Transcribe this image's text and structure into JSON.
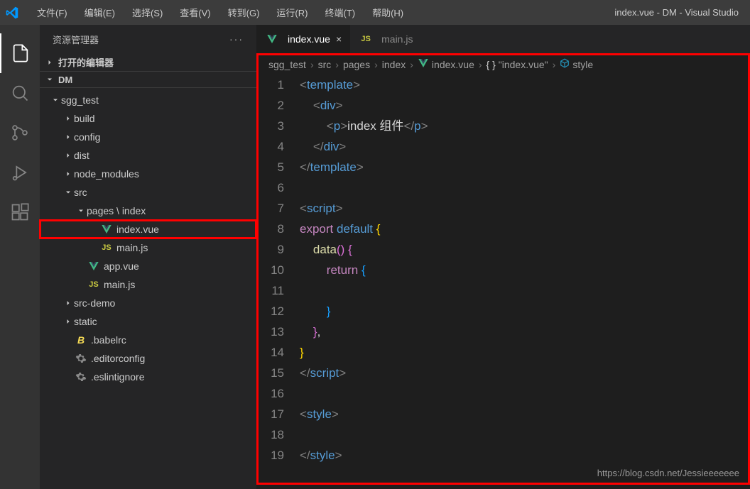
{
  "menus": [
    "文件(F)",
    "编辑(E)",
    "选择(S)",
    "查看(V)",
    "转到(G)",
    "运行(R)",
    "终端(T)",
    "帮助(H)"
  ],
  "window_title": "index.vue - DM - Visual Studio",
  "sidebar": {
    "title": "资源管理器",
    "open_editors": "打开的编辑器",
    "workspace": "DM"
  },
  "tree": [
    {
      "depth": 0,
      "type": "folder",
      "open": true,
      "label": "sgg_test"
    },
    {
      "depth": 1,
      "type": "folder",
      "open": false,
      "label": "build"
    },
    {
      "depth": 1,
      "type": "folder",
      "open": false,
      "label": "config"
    },
    {
      "depth": 1,
      "type": "folder",
      "open": false,
      "label": "dist"
    },
    {
      "depth": 1,
      "type": "folder",
      "open": false,
      "label": "node_modules"
    },
    {
      "depth": 1,
      "type": "folder",
      "open": true,
      "label": "src"
    },
    {
      "depth": 2,
      "type": "folder",
      "open": true,
      "label": "pages \\ index"
    },
    {
      "depth": 3,
      "type": "file",
      "icon": "vue",
      "label": "index.vue",
      "highlight": true,
      "selected": false
    },
    {
      "depth": 3,
      "type": "file",
      "icon": "js",
      "label": "main.js"
    },
    {
      "depth": 2,
      "type": "file",
      "icon": "vue",
      "label": "app.vue"
    },
    {
      "depth": 2,
      "type": "file",
      "icon": "js",
      "label": "main.js"
    },
    {
      "depth": 1,
      "type": "folder",
      "open": false,
      "label": "src-demo"
    },
    {
      "depth": 1,
      "type": "folder",
      "open": false,
      "label": "static"
    },
    {
      "depth": 1,
      "type": "file",
      "icon": "babel",
      "label": ".babelrc"
    },
    {
      "depth": 1,
      "type": "file",
      "icon": "gear",
      "label": ".editorconfig"
    },
    {
      "depth": 1,
      "type": "file",
      "icon": "gear",
      "label": ".eslintignore"
    }
  ],
  "tabs": [
    {
      "icon": "vue",
      "label": "index.vue",
      "active": true,
      "close": true
    },
    {
      "icon": "js",
      "label": "main.js",
      "active": false,
      "close": false
    }
  ],
  "breadcrumbs": [
    "sgg_test",
    "src",
    "pages",
    "index",
    "index.vue",
    "\"index.vue\"",
    "style"
  ],
  "breadcrumb_icons": [
    "",
    "",
    "",
    "",
    "vue",
    "braces",
    "cube"
  ],
  "code": [
    [
      {
        "c": "tk-gray",
        "t": "<"
      },
      {
        "c": "tk-tag",
        "t": "template"
      },
      {
        "c": "tk-gray",
        "t": ">"
      }
    ],
    [
      {
        "c": "",
        "t": "    "
      },
      {
        "c": "tk-gray",
        "t": "<"
      },
      {
        "c": "tk-tag",
        "t": "div"
      },
      {
        "c": "tk-gray",
        "t": ">"
      }
    ],
    [
      {
        "c": "",
        "t": "        "
      },
      {
        "c": "tk-gray",
        "t": "<"
      },
      {
        "c": "tk-tag",
        "t": "p"
      },
      {
        "c": "tk-gray",
        "t": ">"
      },
      {
        "c": "tk-text",
        "t": "index 组件"
      },
      {
        "c": "tk-gray",
        "t": "</"
      },
      {
        "c": "tk-tag",
        "t": "p"
      },
      {
        "c": "tk-gray",
        "t": ">"
      }
    ],
    [
      {
        "c": "",
        "t": "    "
      },
      {
        "c": "tk-gray",
        "t": "</"
      },
      {
        "c": "tk-tag",
        "t": "div"
      },
      {
        "c": "tk-gray",
        "t": ">"
      }
    ],
    [
      {
        "c": "tk-gray",
        "t": "</"
      },
      {
        "c": "tk-tag",
        "t": "template"
      },
      {
        "c": "tk-gray",
        "t": ">"
      }
    ],
    [],
    [
      {
        "c": "tk-gray",
        "t": "<"
      },
      {
        "c": "tk-tag",
        "t": "script"
      },
      {
        "c": "tk-gray",
        "t": ">"
      }
    ],
    [
      {
        "c": "tk-kw-export",
        "t": "export"
      },
      {
        "c": "",
        "t": " "
      },
      {
        "c": "tk-kw-default",
        "t": "default"
      },
      {
        "c": "",
        "t": " "
      },
      {
        "c": "tk-yellow",
        "t": "{"
      }
    ],
    [
      {
        "c": "",
        "t": "    "
      },
      {
        "c": "tk-func",
        "t": "data"
      },
      {
        "c": "tk-purple",
        "t": "()"
      },
      {
        "c": "",
        "t": " "
      },
      {
        "c": "tk-purple",
        "t": "{"
      }
    ],
    [
      {
        "c": "",
        "t": "        "
      },
      {
        "c": "tk-return",
        "t": "return"
      },
      {
        "c": "",
        "t": " "
      },
      {
        "c": "tk-blue",
        "t": "{"
      }
    ],
    [],
    [
      {
        "c": "",
        "t": "        "
      },
      {
        "c": "tk-blue",
        "t": "}"
      }
    ],
    [
      {
        "c": "",
        "t": "    "
      },
      {
        "c": "tk-purple",
        "t": "}"
      },
      {
        "c": "tk-text",
        "t": ","
      }
    ],
    [
      {
        "c": "tk-yellow",
        "t": "}"
      }
    ],
    [
      {
        "c": "tk-gray",
        "t": "</"
      },
      {
        "c": "tk-tag",
        "t": "script"
      },
      {
        "c": "tk-gray",
        "t": ">"
      }
    ],
    [],
    [
      {
        "c": "tk-gray",
        "t": "<"
      },
      {
        "c": "tk-tag",
        "t": "style"
      },
      {
        "c": "tk-gray",
        "t": ">"
      }
    ],
    [],
    [
      {
        "c": "tk-gray",
        "t": "</"
      },
      {
        "c": "tk-tag",
        "t": "style"
      },
      {
        "c": "tk-gray",
        "t": ">"
      }
    ]
  ],
  "watermark": "https://blog.csdn.net/Jessieeeeeee"
}
